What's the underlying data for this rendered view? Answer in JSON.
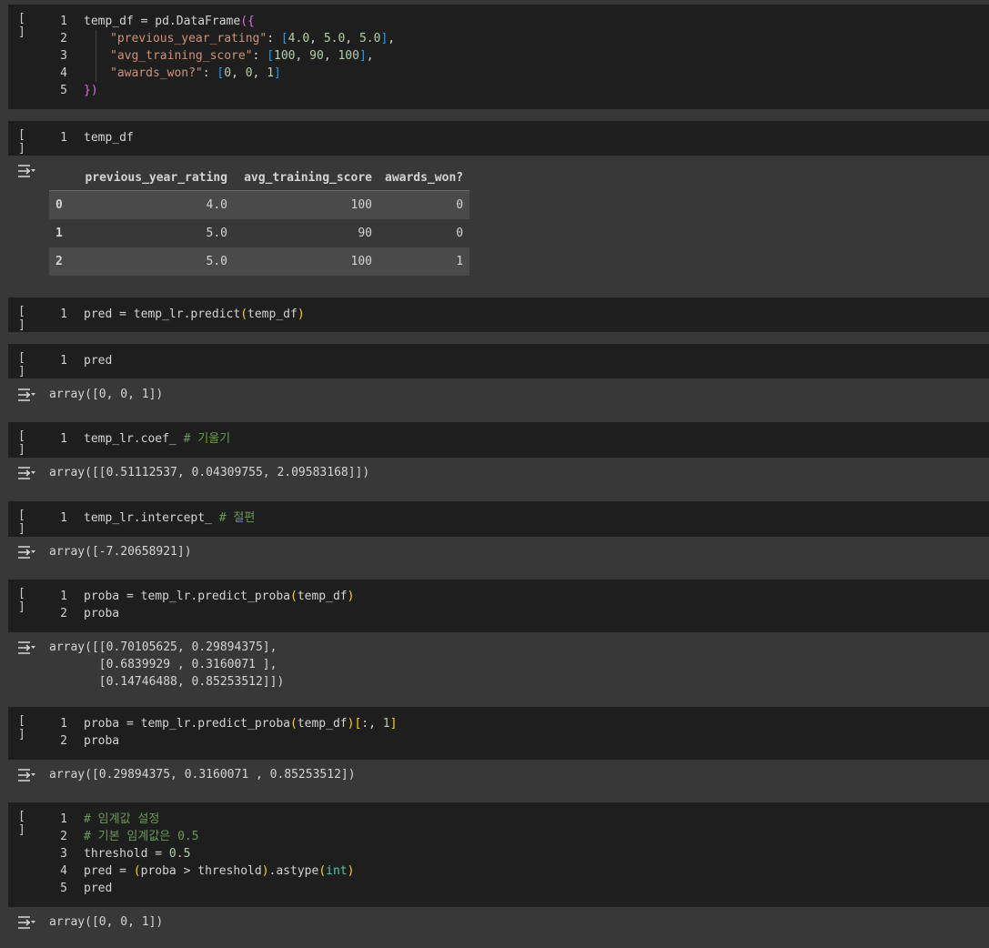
{
  "run_label": "[ ]",
  "cells": [
    {
      "id": 1,
      "lines": [
        [
          "1",
          "temp_df = pd.DataFrame({"
        ],
        [
          "2",
          "\"previous_year_rating\": [4.0, 5.0, 5.0],"
        ],
        [
          "3",
          "\"avg_training_score\": [100, 90, 100],"
        ],
        [
          "4",
          "\"awards_won?\": [0, 0, 1]"
        ],
        [
          "5",
          "})"
        ]
      ]
    },
    {
      "id": 2,
      "lines": [
        [
          "1",
          "temp_df"
        ]
      ]
    },
    {
      "id": 3,
      "lines": [
        [
          "1",
          "pred = temp_lr.predict(temp_df)"
        ]
      ]
    },
    {
      "id": 4,
      "lines": [
        [
          "1",
          "pred"
        ]
      ]
    },
    {
      "id": 5,
      "lines": [
        [
          "1",
          "temp_lr.coef_ # 기울기"
        ]
      ]
    },
    {
      "id": 6,
      "lines": [
        [
          "1",
          "temp_lr.intercept_ # 절편"
        ]
      ]
    },
    {
      "id": 7,
      "lines": [
        [
          "1",
          "proba = temp_lr.predict_proba(temp_df)"
        ],
        [
          "2",
          "proba"
        ]
      ]
    },
    {
      "id": 8,
      "lines": [
        [
          "1",
          "proba = temp_lr.predict_proba(temp_df)[:, 1]"
        ],
        [
          "2",
          "proba"
        ]
      ]
    },
    {
      "id": 9,
      "lines": [
        [
          "1",
          "# 임계값 설정"
        ],
        [
          "2",
          "# 기본 임계값은 0.5"
        ],
        [
          "3",
          "threshold = 0.5"
        ],
        [
          "4",
          "pred = (proba > threshold).astype(int)"
        ],
        [
          "5",
          "pred"
        ]
      ]
    }
  ],
  "dataframe": {
    "columns": [
      "",
      "previous_year_rating",
      "avg_training_score",
      "awards_won?"
    ],
    "rows": [
      [
        "0",
        "4.0",
        "100",
        "0"
      ],
      [
        "1",
        "5.0",
        "90",
        "0"
      ],
      [
        "2",
        "5.0",
        "100",
        "1"
      ]
    ]
  },
  "outputs": {
    "pred": "array([0, 0, 1])",
    "coef": "array([[0.51112537, 0.04309755, 2.09583168]])",
    "intercept": "array([-7.20658921])",
    "proba_full": "array([[0.70105625, 0.29894375],\n       [0.6839929 , 0.3160071 ],\n       [0.14746488, 0.85253512]])",
    "proba_col": "array([0.29894375, 0.3160071 , 0.85253512])",
    "pred_threshold": "array([0, 0, 1])"
  },
  "colors": {
    "cell_bg": "#1e1e1e",
    "output_bg": "#383838",
    "string": "#ce9178",
    "number": "#b5cea8",
    "comment": "#6a9955"
  }
}
